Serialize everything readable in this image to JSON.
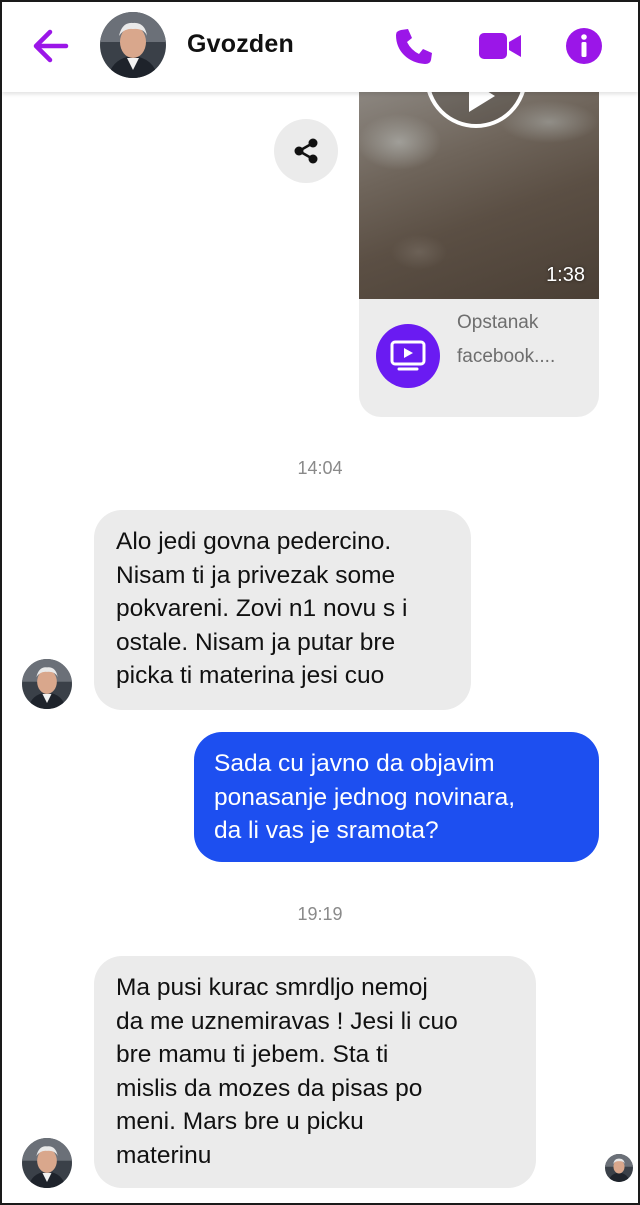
{
  "header": {
    "contact_name": "Gvozden",
    "accent_color": "#9b16e8",
    "icons": [
      "back-arrow-icon",
      "phone-icon",
      "video-camera-icon",
      "info-icon"
    ]
  },
  "shared_video": {
    "duration": "1:38",
    "title": "Opstanak",
    "source": "facebook....",
    "icons": [
      "share-icon",
      "play-icon",
      "video-app-icon"
    ]
  },
  "messages": {
    "timestamp_1": "14:04",
    "timestamp_2": "19:19",
    "msg1": {
      "direction": "incoming",
      "lines": [
        "Alo jedi govna pedercino.",
        "Nisam ti ja privezak some",
        "pokvareni. Zovi n1 novu s i",
        "ostale. Nisam ja putar bre",
        "picka ti materina jesi cuo"
      ]
    },
    "msg2": {
      "direction": "outgoing",
      "lines": [
        "Sada cu javno da objavim",
        "ponasanje jednog novinara,",
        "da li vas je sramota?"
      ]
    },
    "msg3": {
      "direction": "incoming",
      "lines": [
        "Ma pusi kurac smrdljo nemoj",
        "da me uznemiravas ! Jesi li cuo",
        "bre mamu ti jebem. Sta ti",
        "mislis da mozes da pisas po",
        "meni. Mars bre u picku",
        "materinu"
      ]
    }
  },
  "colors": {
    "outgoing_bubble": "#1d4ff0",
    "incoming_bubble": "#ebebeb",
    "video_logo_bg": "#6a1bf2"
  }
}
